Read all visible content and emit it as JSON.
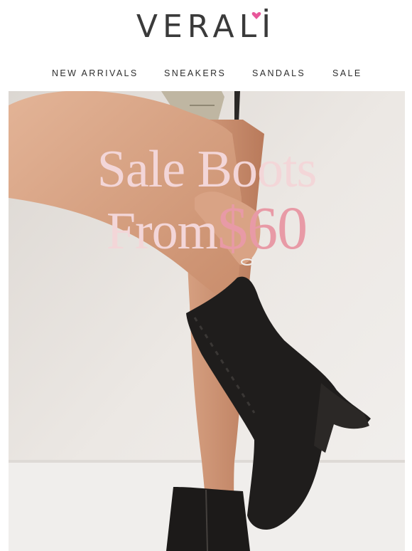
{
  "brand": {
    "name": "VERALİ"
  },
  "nav": {
    "items": [
      {
        "label": "NEW ARRIVALS"
      },
      {
        "label": "SNEAKERS"
      },
      {
        "label": "SANDALS"
      },
      {
        "label": "SALE"
      }
    ]
  },
  "hero": {
    "headline_line1": "Sale Boots",
    "headline_from": "From",
    "headline_price": "$60"
  },
  "colors": {
    "heart_accent": "#e8579a",
    "headline_light_pink": "#f3d6d8",
    "headline_price_pink": "#e89aa6",
    "boot_black": "#1f1d1c"
  }
}
